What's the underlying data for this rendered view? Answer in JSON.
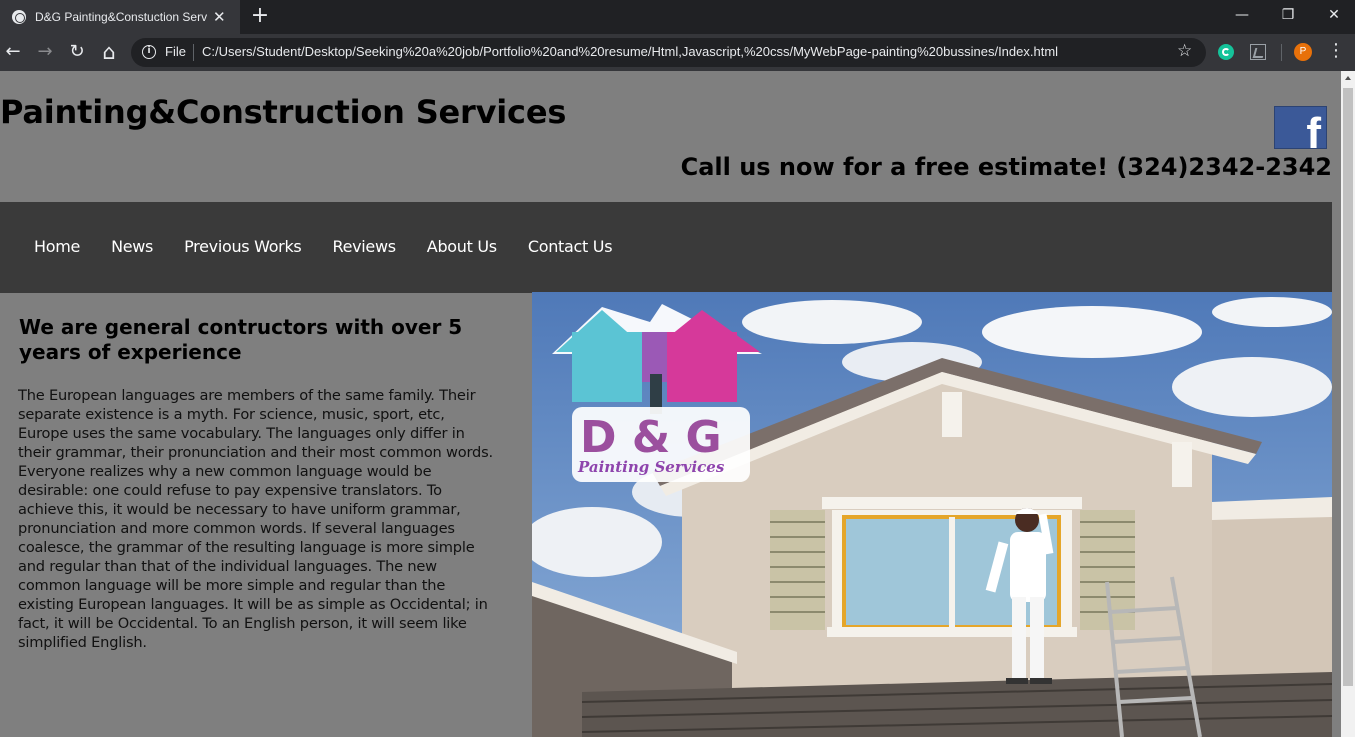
{
  "browser": {
    "tab_title": "D&G Painting&Constuction Serv",
    "tab_close": "✕",
    "new_tab": "+",
    "window_controls": {
      "minimize": "—",
      "restore": "❐",
      "close": "✕"
    },
    "toolbar": {
      "back": "←",
      "forward": "→",
      "reload": "↻",
      "home": "⌂",
      "file_label": "File",
      "url": "C:/Users/Student/Desktop/Seeking%20a%20job/Portfolio%20and%20resume/Html,Javascript,%20css/MyWebPage-painting%20bussines/Index.html",
      "star": "☆",
      "profile_initial": "P",
      "menu": "⋮"
    }
  },
  "header": {
    "title": "Painting&Construction Services",
    "facebook_icon": "f",
    "call_text": "Call us now for a free estimate! (324)2342-2342"
  },
  "nav": {
    "items": [
      "Home",
      "News",
      "Previous Works",
      "Reviews",
      "About Us",
      "Contact Us"
    ]
  },
  "main": {
    "heading": "We are general contructors with over 5 years of experience",
    "body": "The European languages are members of the same family. Their separate existence is a myth. For science, music, sport, etc, Europe uses the same vocabulary. The languages only differ in their grammar, their pronunciation and their most common words. Everyone realizes why a new common language would be desirable: one could refuse to pay expensive translators. To achieve this, it would be necessary to have uniform grammar, pronunciation and more common words. If several languages coalesce, the grammar of the resulting language is more simple and regular than that of the individual languages. The new common language will be more simple and regular than the existing European languages. It will be as simple as Occidental; in fact, it will be Occidental. To an English person, it will seem like simplified English."
  },
  "hero": {
    "logo_line1": "D & G",
    "logo_line2": "Painting Services"
  },
  "colors": {
    "page_bg": "#7f7f7f",
    "nav_bg": "#3a3a3a",
    "facebook": "#3b5998",
    "chrome_dark": "#202124",
    "chrome_toolbar": "#35363a"
  }
}
